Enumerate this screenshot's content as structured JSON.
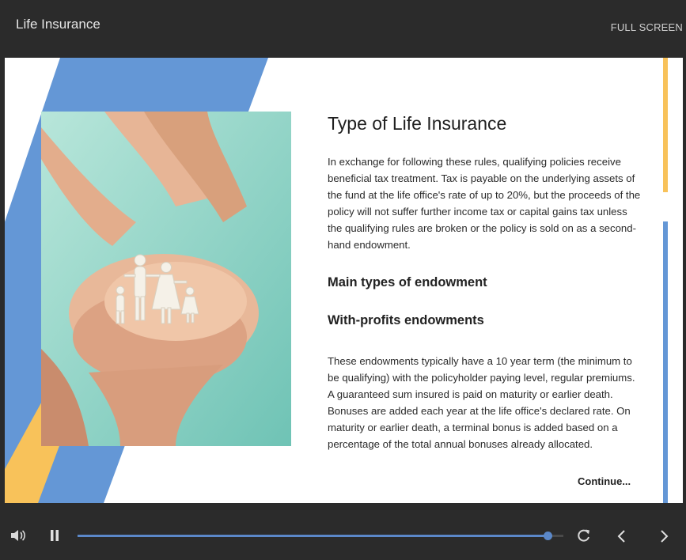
{
  "header": {
    "title": "Life Insurance",
    "fullscreen_label": "FULL SCREEN"
  },
  "slide": {
    "title": "Type of  Life Insurance",
    "paragraph1": "In exchange for following these rules, qualifying policies receive beneficial tax treatment. Tax is payable on the underlying assets of the fund at the life office's rate of up to 20%, but the proceeds of the policy will not suffer further income tax or capital gains tax unless the qualifying rules are broken or the policy is sold on as a second-hand endowment.",
    "subheading1": "Main types of endowment",
    "subheading2": "With-profits endowments",
    "paragraph2": "These endowments typically have a 10 year term (the minimum to be qualifying) with the policyholder paying level, regular premiums. A guaranteed sum insured is paid on maturity or earlier death. Bonuses are added each year at the life office's declared rate. On maturity or earlier death, a terminal bonus is added based on a percentage of the total annual bonuses already allocated.",
    "continue_label": "Continue..."
  },
  "player": {
    "progress_fraction": 0.967
  },
  "colors": {
    "accent_blue": "#6497d6",
    "accent_yellow": "#f8c25a",
    "background_dark": "#2b2b2b"
  },
  "icons": [
    "volume-icon",
    "pause-icon",
    "replay-icon",
    "chevron-left-icon",
    "chevron-right-icon"
  ]
}
